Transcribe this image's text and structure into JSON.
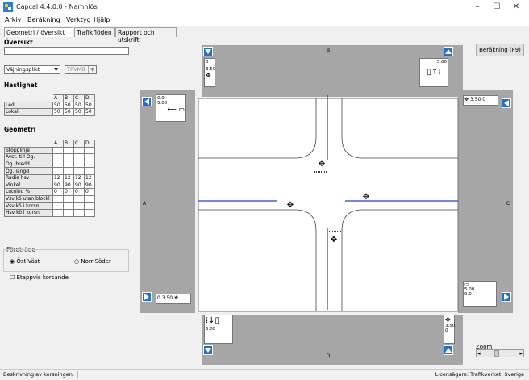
{
  "window": {
    "title": "Capcal 4.4.0.0 - Namnlös",
    "minimize": "–",
    "maximize": "☐",
    "close": "✕"
  },
  "menu": [
    "Arkiv",
    "Beräkning",
    "Verktyg",
    "Hjälp"
  ],
  "tabs": [
    "Geometri / översikt",
    "Trafikflöden",
    "Rapport och utskrift"
  ],
  "calc_button": "Beräkning (F9)",
  "overview": {
    "title": "Översikt",
    "name_value": "",
    "rule_select": "Väjningsplikt",
    "speed_select": "TRVMB"
  },
  "speed": {
    "title": "Hastighet",
    "columns": [
      "A",
      "B",
      "C",
      "D"
    ],
    "rows": [
      {
        "label": "Led",
        "values": [
          "50",
          "50",
          "50",
          "50"
        ]
      },
      {
        "label": "Lokal",
        "values": [
          "50",
          "50",
          "50",
          "50"
        ]
      }
    ]
  },
  "geometry": {
    "title": "Geometri",
    "columns": [
      "A",
      "B",
      "C",
      "D"
    ],
    "rows": [
      {
        "label": "Stopplinje",
        "values": [
          "",
          "",
          "",
          ""
        ],
        "gray": true
      },
      {
        "label": "Avst. till Ög.",
        "values": [
          "",
          "",
          "",
          ""
        ],
        "gray": true
      },
      {
        "label": "Ög. bredd",
        "values": [
          "",
          "",
          "",
          ""
        ],
        "gray": true
      },
      {
        "label": "Ög. längd",
        "values": [
          "",
          "",
          "",
          ""
        ],
        "gray": true
      },
      {
        "label": "Radie hsv",
        "values": [
          "12",
          "12",
          "12",
          "12"
        ],
        "gray": false
      },
      {
        "label": "Vinkel",
        "values": [
          "90",
          "90",
          "90",
          "90"
        ],
        "gray": false
      },
      {
        "label": "Lutning %",
        "values": [
          "0",
          "0",
          "0",
          "0"
        ],
        "gray": false
      },
      {
        "label": "Vsv kö utan blockl",
        "values": [
          "",
          "",
          "",
          ""
        ],
        "gray": true
      },
      {
        "label": "Vsv kö i korsn",
        "values": [
          "",
          "",
          "",
          ""
        ],
        "gray": true
      },
      {
        "label": "Hsv kö i korsn",
        "values": [
          "",
          "",
          "",
          ""
        ],
        "gray": true
      }
    ]
  },
  "priority": {
    "title": "Företräde",
    "options": [
      "Öst-Väst",
      "Norr-Söder"
    ],
    "selected": 0
  },
  "staged_crossing": "Etappvis korsande",
  "legs": {
    "A": "A",
    "B": "B",
    "C": "C",
    "D": "D"
  },
  "top_arm": {
    "left_values": [
      "0",
      "3.50"
    ],
    "right_value": "5.00"
  },
  "left_arm": {
    "values": [
      "0.0",
      "5.00"
    ]
  },
  "right_arm": {
    "values": [
      "3.50",
      "0"
    ]
  },
  "bottom_left_arm": {
    "values": [
      "0",
      "3.50"
    ]
  },
  "bottom_arm": {
    "left_value": "5.00",
    "right_values": [
      "3.50",
      "0"
    ]
  },
  "right_lower_arm": {
    "values": [
      "5.00",
      "0.0"
    ]
  },
  "zoom_label": "Zoom",
  "status": {
    "left": "Beskrivning av korsningen.",
    "right": "Licensägare: Trafikverket, Sverige"
  },
  "colors": {
    "accent": "#1f6fd9",
    "lane": "#1f3fd9",
    "arm_gray": "#a6a6a6"
  }
}
